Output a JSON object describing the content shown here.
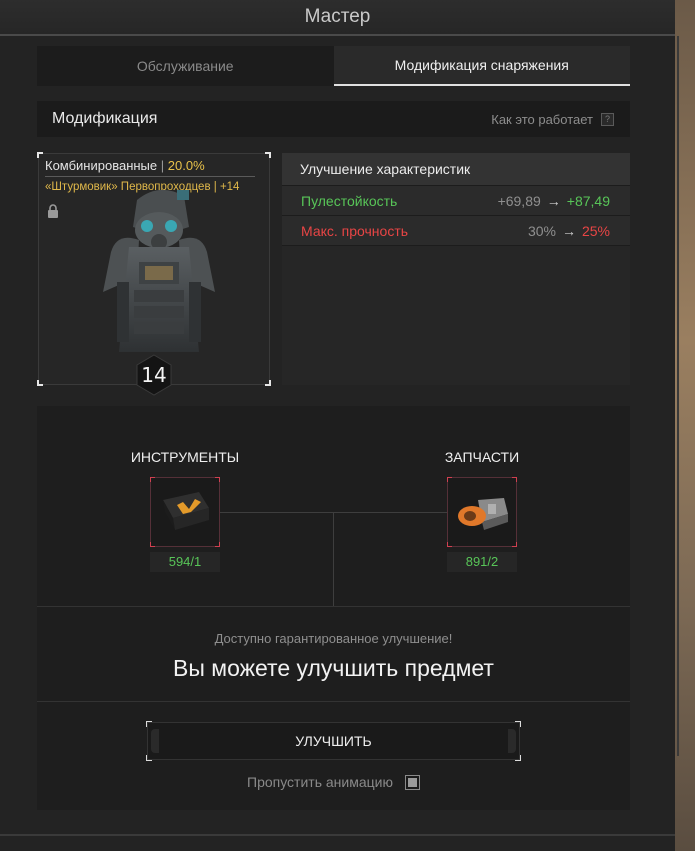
{
  "window": {
    "title": "Мастер"
  },
  "tabs": [
    {
      "label": "Обслуживание",
      "active": false
    },
    {
      "label": "Модификация снаряжения",
      "active": true
    }
  ],
  "section": {
    "title": "Модификация",
    "how_it_works": "Как это работает",
    "help_icon": "?"
  },
  "item": {
    "category": "Комбинированные",
    "separator": "|",
    "category_percent": "20.0%",
    "name": "«Штурмовик» Первопроходцев | +14",
    "icon": "lock-icon",
    "level": "14"
  },
  "stats": {
    "header": "Улучшение характеристик",
    "rows": [
      {
        "name": "Пулестойкость",
        "from": "+69,89",
        "arrow": "→",
        "to": "+87,49",
        "color": "#58c558"
      },
      {
        "name": "Макс. прочность",
        "from": "30%",
        "arrow": "→",
        "to": "25%",
        "color": "#e84545"
      }
    ]
  },
  "materials": {
    "tools": {
      "title": "ИНСТРУМЕНТЫ",
      "count": "594/1"
    },
    "parts": {
      "title": "ЗАПЧАСТИ",
      "count": "891/2"
    }
  },
  "upgrade": {
    "guaranteed_text": "Доступно гарантированное улучшение!",
    "can_upgrade_text": "Вы можете улучшить предмет",
    "button_label": "УЛУЧШИТЬ",
    "skip_animation_label": "Пропустить анимацию",
    "skip_animation_checked": true
  }
}
